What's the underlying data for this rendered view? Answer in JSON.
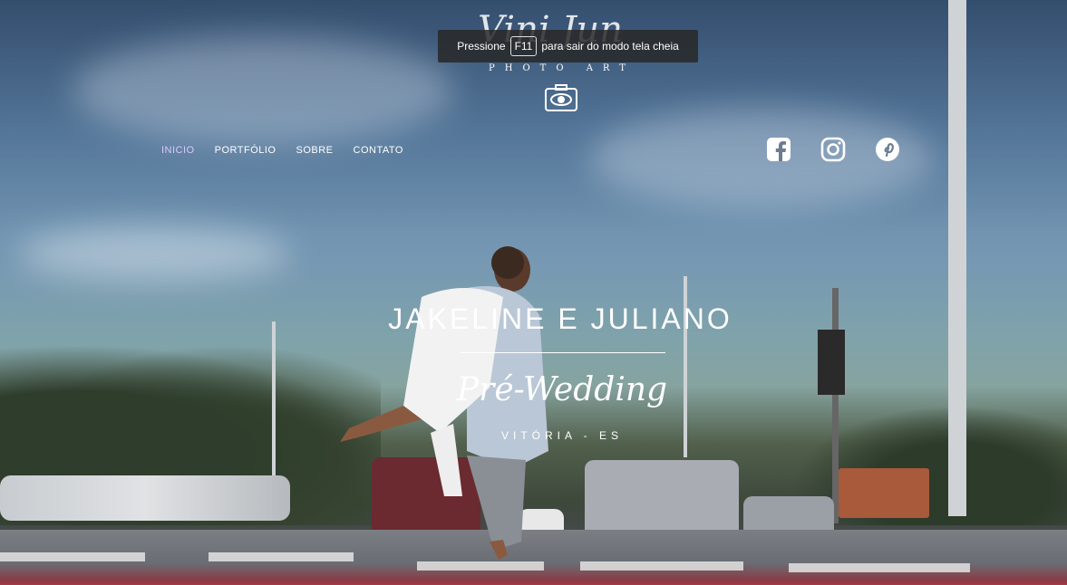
{
  "browser": {
    "fullscreen_notice": {
      "prefix": "Pressione",
      "key": "F11",
      "suffix": "para sair do modo tela cheia"
    }
  },
  "logo": {
    "script_text": "Vini Jun",
    "subtitle": "PHOTO ART",
    "icon": "camera-eye-icon"
  },
  "nav": {
    "items": [
      {
        "label": "INICIO",
        "active": true
      },
      {
        "label": "PORTFÓLIO",
        "active": false
      },
      {
        "label": "SOBRE",
        "active": false
      },
      {
        "label": "CONTATO",
        "active": false
      }
    ]
  },
  "social": [
    {
      "name": "facebook-icon"
    },
    {
      "name": "instagram-icon"
    },
    {
      "name": "pinterest-icon"
    }
  ],
  "hero": {
    "title": "JAKELINE E JULIANO",
    "subtitle": "Pré-Wedding",
    "location": "VITÓRIA - ES"
  },
  "colors": {
    "active_nav": "#d9c8ff",
    "text": "#ffffff"
  }
}
